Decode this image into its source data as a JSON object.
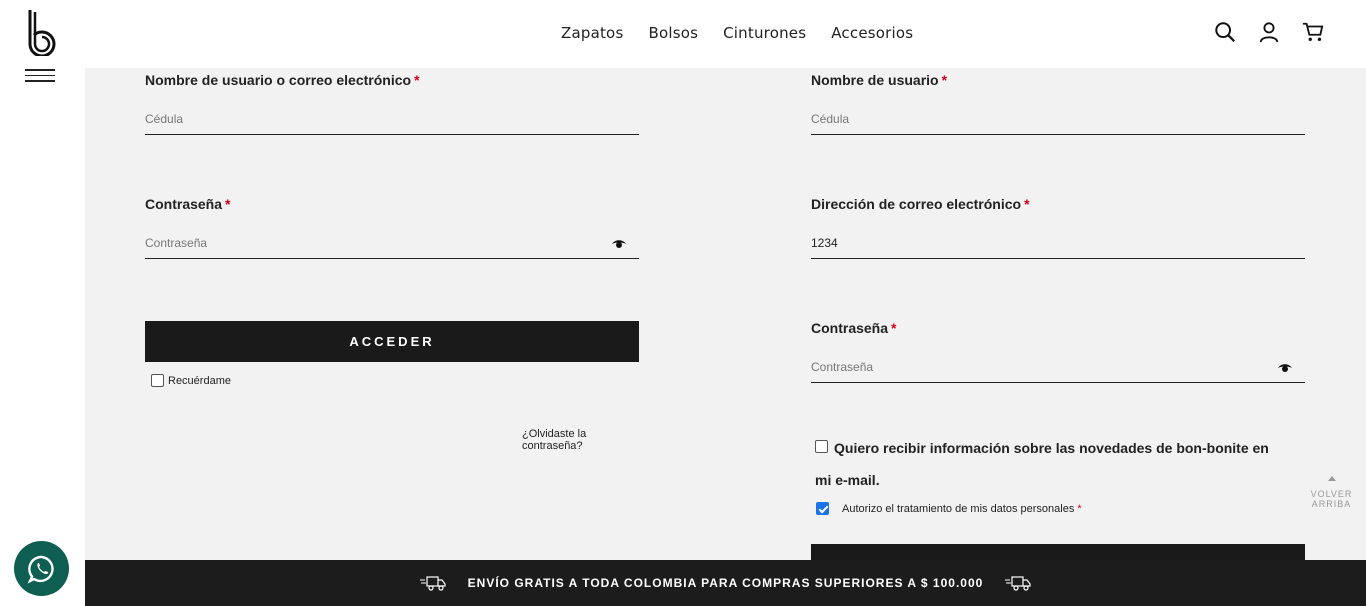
{
  "header": {
    "nav": [
      "Zapatos",
      "Bolsos",
      "Cinturones",
      "Accesorios"
    ],
    "icons": [
      "search-icon",
      "user-icon",
      "cart-icon"
    ]
  },
  "login": {
    "username_label": "Nombre de usuario o correo electrónico",
    "username_placeholder": "Cédula",
    "password_label": "Contraseña",
    "password_placeholder": "Contraseña",
    "submit_label": "ACCEDER",
    "remember_label": "Recuérdame",
    "forgot_label": "¿Olvidaste la contraseña?"
  },
  "register": {
    "username_label": "Nombre de usuario",
    "username_placeholder": "Cédula",
    "email_label": "Dirección de correo electrónico",
    "email_value": "1234",
    "password_label": "Contraseña",
    "password_placeholder": "Contraseña",
    "newsletter_label": "Quiero recibir información sobre las novedades de bon-bonite en mi e-mail.",
    "newsletter_checked": false,
    "consent_label": "Autorizo el tratamiento de mis datos personales",
    "consent_checked": true,
    "required_mark": "*"
  },
  "footer": {
    "shipping_banner": "ENVÍO GRATIS A TODA COLOMBIA PARA COMPRAS SUPERIORES A $ 100.000"
  },
  "back_to_top": {
    "line1": "VOLVER",
    "line2": "ARRIBA"
  },
  "colors": {
    "required": "#d0021b",
    "dark": "#1a1a1a",
    "whatsapp": "#0e5f52",
    "checkbox_checked": "#1a73e8"
  }
}
